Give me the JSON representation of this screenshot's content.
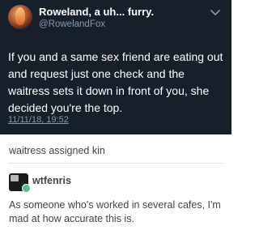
{
  "tweet": {
    "display_name": "Roweland, a uh... furry.",
    "handle": "@RowelandFox",
    "text": "If you and a same sex friend are eating out and request just one check and the waitress sets it down in front of you, she decided you're the top.",
    "date": "11/11/18, 19:52",
    "icons": [
      "avatar",
      "chevron-down-icon"
    ]
  },
  "post": {
    "caption": "waitress assigned kin",
    "reblog": {
      "username": "wtfenris",
      "text": "As someone who's worked in several cafes, I'm mad at how accurate this is."
    }
  },
  "colors": {
    "tweet_background": "#15202b",
    "tweet_secondary": "#8899a6",
    "tumblr_text": "#444444",
    "badge_green": "#56bc8a"
  }
}
